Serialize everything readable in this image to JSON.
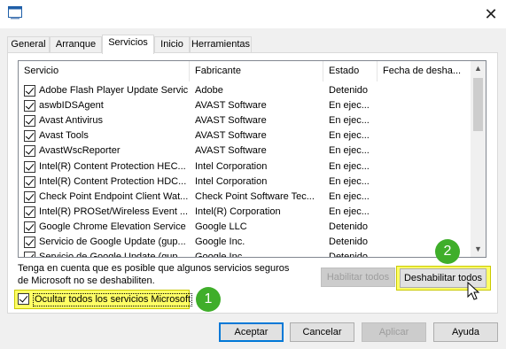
{
  "window": {
    "close_glyph": "✕",
    "icon": "app-window-icon"
  },
  "tabs": [
    {
      "label": "General"
    },
    {
      "label": "Arranque"
    },
    {
      "label": "Servicios"
    },
    {
      "label": "Inicio"
    },
    {
      "label": "Herramientas"
    }
  ],
  "active_tab": "Servicios",
  "services": {
    "columns": [
      "Servicio",
      "Fabricante",
      "Estado",
      "Fecha de desha..."
    ],
    "rows": [
      {
        "name": "Adobe Flash Player Update Service",
        "maker": "Adobe",
        "status": "Detenido",
        "checked": true
      },
      {
        "name": "aswbIDSAgent",
        "maker": "AVAST Software",
        "status": "En ejec...",
        "checked": true
      },
      {
        "name": "Avast Antivirus",
        "maker": "AVAST Software",
        "status": "En ejec...",
        "checked": true
      },
      {
        "name": "Avast Tools",
        "maker": "AVAST Software",
        "status": "En ejec...",
        "checked": true
      },
      {
        "name": "AvastWscReporter",
        "maker": "AVAST Software",
        "status": "En ejec...",
        "checked": true
      },
      {
        "name": "Intel(R) Content Protection HEC...",
        "maker": "Intel Corporation",
        "status": "En ejec...",
        "checked": true
      },
      {
        "name": "Intel(R) Content Protection HDC...",
        "maker": "Intel Corporation",
        "status": "En ejec...",
        "checked": true
      },
      {
        "name": "Check Point Endpoint Client Wat...",
        "maker": "Check Point Software Tec...",
        "status": "En ejec...",
        "checked": true
      },
      {
        "name": "Intel(R) PROSet/Wireless Event ...",
        "maker": "Intel(R) Corporation",
        "status": "En ejec...",
        "checked": true
      },
      {
        "name": "Google Chrome Elevation Service",
        "maker": "Google LLC",
        "status": "Detenido",
        "checked": true
      },
      {
        "name": "Servicio de Google Update (gup...",
        "maker": "Google Inc.",
        "status": "Detenido",
        "checked": true
      },
      {
        "name": "Servicio de Google Update (gup...",
        "maker": "Google Inc.",
        "status": "Detenido",
        "checked": true
      }
    ]
  },
  "note": "Tenga en cuenta que es posible que algunos servicios seguros de Microsoft no se deshabiliten.",
  "buttons": {
    "enable_all": "Habilitar todos",
    "disable_all": "Deshabilitar todos",
    "accept": "Aceptar",
    "cancel": "Cancelar",
    "apply": "Aplicar",
    "help": "Ayuda"
  },
  "hide_ms": {
    "label": "Ocultar todos los servicios Microsoft",
    "checked": true
  },
  "callouts": {
    "one": "1",
    "two": "2"
  },
  "colors": {
    "highlight": "#ffff66",
    "callout_green": "#3fae2a",
    "focus_blue": "#0078d7"
  }
}
